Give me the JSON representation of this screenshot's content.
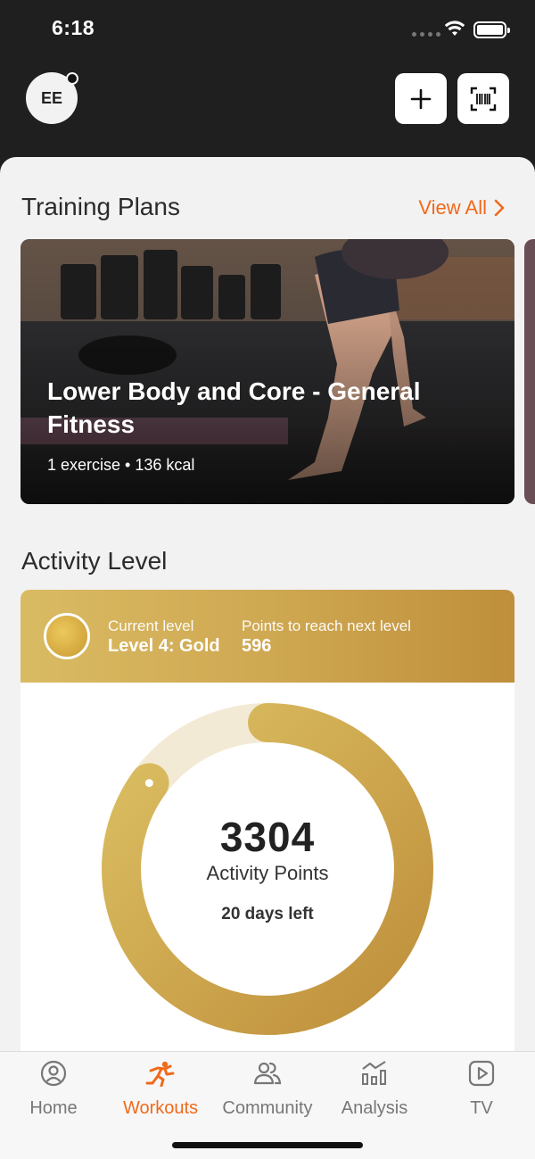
{
  "status_bar": {
    "time": "6:18"
  },
  "header": {
    "avatar_initials": "EE"
  },
  "training_plans": {
    "title": "Training Plans",
    "view_all": "View All",
    "card": {
      "title": "Lower Body and Core - General Fitness",
      "meta": "1 exercise • 136 kcal"
    }
  },
  "activity": {
    "title": "Activity Level",
    "current_level_label": "Current level",
    "current_level_value": "Level 4: Gold",
    "points_next_label": "Points to reach next level",
    "points_next_value": "596",
    "points_value": "3304",
    "points_label": "Activity Points",
    "days_left": "20 days left",
    "progress_fraction": 0.85
  },
  "tabs": [
    {
      "label": "Home",
      "icon": "person-circle-icon",
      "active": false
    },
    {
      "label": "Workouts",
      "icon": "running-figure-icon",
      "active": true
    },
    {
      "label": "Community",
      "icon": "people-icon",
      "active": false
    },
    {
      "label": "Analysis",
      "icon": "bar-chart-icon",
      "active": false
    },
    {
      "label": "TV",
      "icon": "play-icon",
      "active": false
    }
  ],
  "colors": {
    "accent": "#f06a1b",
    "gold_light": "#d9bb63",
    "gold_dark": "#bf8f3b",
    "ring_track": "#f3ead5"
  }
}
